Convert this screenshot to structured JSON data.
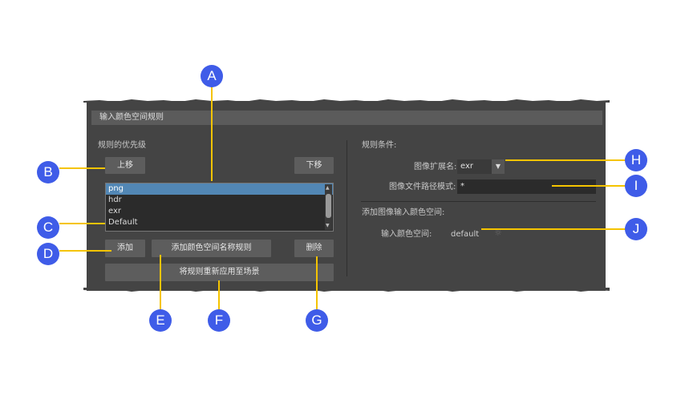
{
  "panel": {
    "title": "输入颜色空间规则",
    "priority_label": "规则的优先级",
    "move_up_button": "上移",
    "move_down_button": "下移",
    "rules": [
      "png",
      "hdr",
      "exr",
      "Default"
    ],
    "add_button": "添加",
    "add_name_rule_button": "添加颜色空间名称规则",
    "delete_button": "删除",
    "reapply_button": "将规则重新应用至场景",
    "conditions_label": "规则条件:",
    "ext_label": "图像扩展名:",
    "ext_value": "exr",
    "path_pattern_label": "图像文件路径模式:",
    "path_pattern_value": "*",
    "add_input_label": "添加图像输入颜色空间:",
    "input_space_label": "输入颜色空间:",
    "input_space_value": "default"
  },
  "callouts": [
    "A",
    "B",
    "C",
    "D",
    "E",
    "F",
    "G",
    "H",
    "I",
    "J"
  ],
  "colors": {
    "callout": "#3f5ce8",
    "leader": "#f5c400",
    "panel": "#444444",
    "selection": "#5287b5"
  }
}
